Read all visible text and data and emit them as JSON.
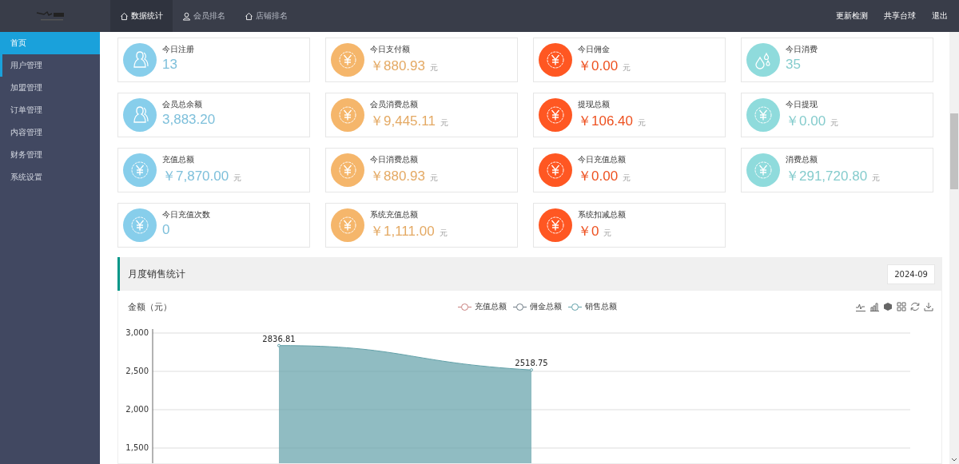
{
  "top_nav": {
    "items": [
      {
        "label": "数据统计",
        "kind": "house",
        "selected": true
      },
      {
        "label": "会员排名",
        "kind": "user",
        "selected": false
      },
      {
        "label": "店铺排名",
        "kind": "house",
        "selected": false
      }
    ],
    "links": [
      "更新检测",
      "共享台球",
      "退出"
    ]
  },
  "sidebar": {
    "items": [
      {
        "label": "首页",
        "selected": true,
        "hovered": false
      },
      {
        "label": "用户管理",
        "selected": false,
        "hovered": true
      },
      {
        "label": "加盟管理",
        "selected": false,
        "hovered": false
      },
      {
        "label": "订单管理",
        "selected": false,
        "hovered": false
      },
      {
        "label": "内容管理",
        "selected": false,
        "hovered": false
      },
      {
        "label": "财务管理",
        "selected": false,
        "hovered": false
      },
      {
        "label": "系统设置",
        "selected": false,
        "hovered": false
      }
    ]
  },
  "stats": [
    {
      "label": "今日注册",
      "value": "13",
      "kind": "users",
      "color": "#87ceeb"
    },
    {
      "label": "今日支付额",
      "value": "￥880.93",
      "unit": "元",
      "kind": "yen",
      "color": "#f5b66b"
    },
    {
      "label": "今日佣金",
      "value": "￥0.00",
      "unit": "元",
      "kind": "yen",
      "color": "#ff5722"
    },
    {
      "label": "今日消费",
      "value": "35",
      "kind": "drops",
      "color": "#8fdbdc"
    },
    {
      "label": "会员总余额",
      "value": "3,883.20",
      "kind": "users",
      "color": "#87ceeb"
    },
    {
      "label": "会员消费总额",
      "value": "￥9,445.11",
      "unit": "元",
      "kind": "yen",
      "color": "#f5b66b"
    },
    {
      "label": "提现总额",
      "value": "￥106.40",
      "unit": "元",
      "kind": "yen",
      "color": "#ff5722"
    },
    {
      "label": "今日提现",
      "value": "￥0.00",
      "unit": "元",
      "kind": "yen",
      "color": "#8fdbdc"
    },
    {
      "label": "充值总额",
      "value": "￥7,870.00",
      "unit": "元",
      "kind": "yen",
      "color": "#87ceeb"
    },
    {
      "label": "今日消费总额",
      "value": "￥880.93",
      "unit": "元",
      "kind": "yen",
      "color": "#f5b66b"
    },
    {
      "label": "今日充值总额",
      "value": "￥0.00",
      "unit": "元",
      "kind": "yen",
      "color": "#ff5722"
    },
    {
      "label": "消费总额",
      "value": "￥291,720.80",
      "unit": "元",
      "kind": "yen",
      "color": "#8fdbdc"
    },
    {
      "label": "今日充值次数",
      "value": "0",
      "kind": "yen",
      "color": "#87ceeb"
    },
    {
      "label": "系统充值总额",
      "value": "￥1,111.00",
      "unit": "元",
      "kind": "yen",
      "color": "#f5b66b"
    },
    {
      "label": "系统扣减总额",
      "value": "￥0",
      "unit": "元",
      "kind": "yen",
      "color": "#ff5722"
    }
  ],
  "sales_panel": {
    "title": "月度销售统计",
    "month": "2024-09",
    "chart_data": {
      "type": "area",
      "title": "金额（元）",
      "grid": true,
      "ylim": [
        1300,
        3000
      ],
      "yticks": [
        {
          "value": 3000,
          "label": "3,000"
        },
        {
          "value": 2500,
          "label": "2,500"
        },
        {
          "value": 2000,
          "label": "2,000"
        },
        {
          "value": 1500,
          "label": "1,500"
        }
      ],
      "data_labels": true,
      "series": [
        {
          "name": "充值总额",
          "color": "#c9807e",
          "values": [
            null,
            null,
            null
          ]
        },
        {
          "name": "佣金总额",
          "color": "#6e7b85",
          "values": [
            null,
            null,
            null
          ]
        },
        {
          "name": "销售总额",
          "color": "#61a0a8",
          "values": [
            2836.81,
            2518.75,
            null
          ]
        }
      ]
    }
  }
}
